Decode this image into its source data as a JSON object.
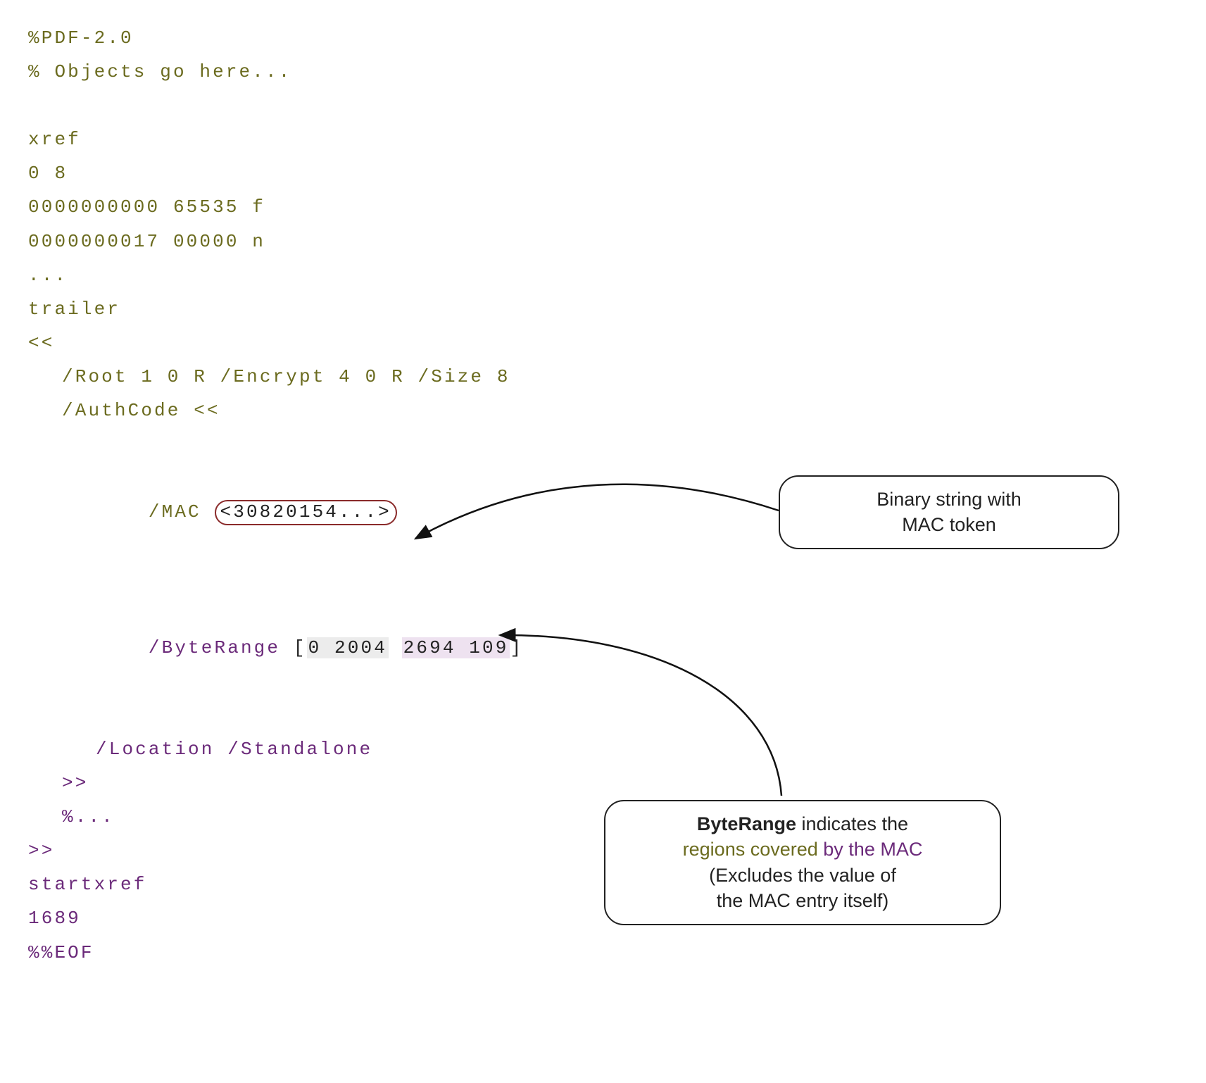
{
  "code": {
    "l1": "%PDF-2.0",
    "l2": "% Objects go here...",
    "l3": "xref",
    "l4": "0 8",
    "l5": "0000000000 65535 f",
    "l6": "0000000017 00000 n",
    "l7": "...",
    "l8": "trailer",
    "l9": "<<",
    "l10": "/Root 1 0 R /Encrypt 4 0 R /Size 8",
    "l11": "/AuthCode <<",
    "l12_key": "/MAC ",
    "l12_val": "<30820154...>",
    "l13_key": "/ByteRange ",
    "l13_b": "[",
    "l13_r1": "0 2004",
    "l13_sp": " ",
    "l13_r2": "2694 109",
    "l13_e": "]",
    "l14": "/Location /Standalone",
    "l15": ">>",
    "l16": "%...",
    "l17": ">>",
    "l18": "startxref",
    "l19": "1689",
    "l20": "%%EOF"
  },
  "callouts": {
    "mac": {
      "line1": "Binary string with",
      "line2": "MAC token"
    },
    "byterange": {
      "w1": "ByteRange",
      "w2": " indicates the",
      "l2a": "regions covered",
      "l2b": " by the MAC",
      "l3": "(Excludes the value of",
      "l4": "the MAC entry itself)"
    }
  }
}
